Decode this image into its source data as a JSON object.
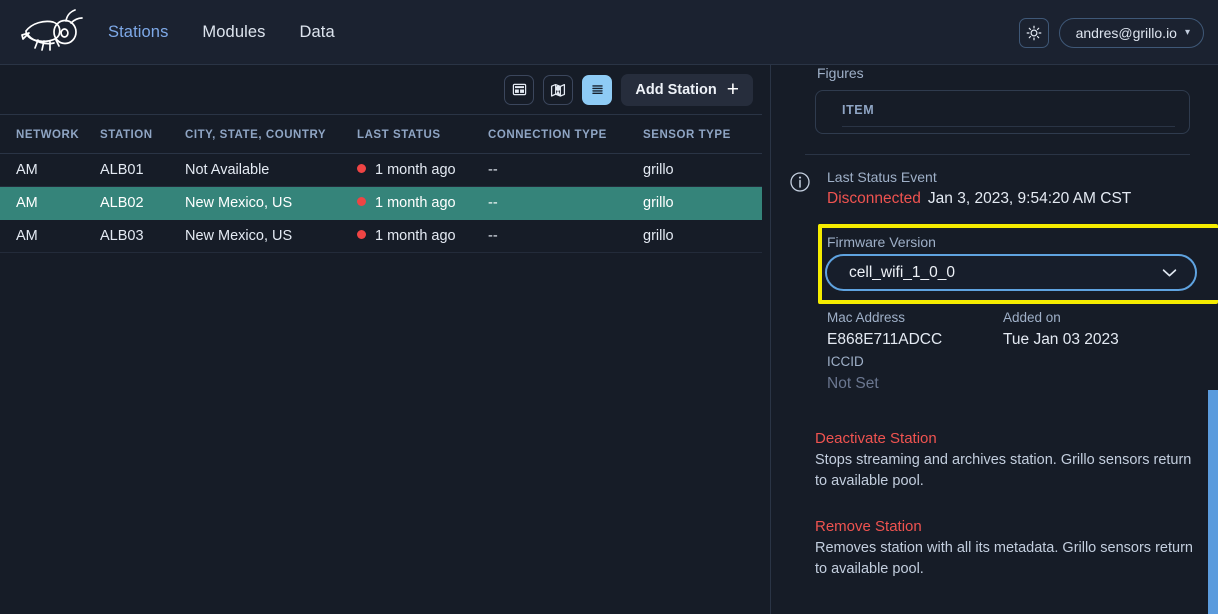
{
  "brand": {
    "logo_icon": "cricket-logo",
    "name": "Grillo"
  },
  "nav": {
    "links": [
      {
        "label": "Stations",
        "active": true
      },
      {
        "label": "Modules",
        "active": false
      },
      {
        "label": "Data",
        "active": false
      }
    ],
    "theme_toggle_icon": "sun-icon",
    "user": {
      "email": "andres@grillo.io",
      "caret_icon": "chevron-down-icon"
    }
  },
  "toolbar": {
    "views": [
      {
        "name": "cards-view",
        "icon": "layout-cards-icon",
        "active": false
      },
      {
        "name": "map-view",
        "icon": "map-pin-icon",
        "active": false
      },
      {
        "name": "list-view",
        "icon": "list-lines-icon",
        "active": true
      }
    ],
    "add_station_label": "Add Station",
    "add_station_icon": "plus-icon",
    "active_color": "#8ecbf5"
  },
  "table": {
    "columns": [
      "NETWORK",
      "STATION",
      "CITY, STATE, COUNTRY",
      "LAST STATUS",
      "CONNECTION TYPE",
      "SENSOR TYPE"
    ],
    "selected_row_color": "#35847a",
    "status_dot_color": "#ef4444",
    "rows": [
      {
        "network": "AM",
        "station": "ALB01",
        "city": "Not Available",
        "city_muted": true,
        "last_status": "1 month ago",
        "connection_type": "--",
        "sensor_type": "grillo",
        "selected": false
      },
      {
        "network": "AM",
        "station": "ALB02",
        "city": "New Mexico, US",
        "city_muted": false,
        "last_status": "1 month ago",
        "connection_type": "--",
        "sensor_type": "grillo",
        "selected": true
      },
      {
        "network": "AM",
        "station": "ALB03",
        "city": "New Mexico, US",
        "city_muted": false,
        "last_status": "1 month ago",
        "connection_type": "--",
        "sensor_type": "grillo",
        "selected": false
      }
    ]
  },
  "details": {
    "figures_label": "Figures",
    "figures_table_header": "ITEM",
    "info_icon": "info-circle-icon",
    "last_status_event_label": "Last Status Event",
    "last_status_event_state": "Disconnected",
    "last_status_event_state_color": "#ef5350",
    "last_status_event_time": "Jan 3, 2023, 9:54:20 AM CST",
    "firmware_label": "Firmware Version",
    "firmware_value": "cell_wifi_1_0_0",
    "firmware_caret_icon": "chevron-down-icon",
    "firmware_highlight_color": "#f5ec00",
    "firmware_border_color": "#5fa3e0",
    "mac_label": "Mac Address",
    "mac_value": "E868E711ADCC",
    "added_label": "Added on",
    "added_value": "Tue Jan 03 2023",
    "iccid_label": "ICCID",
    "iccid_value": "Not Set",
    "actions": [
      {
        "title": "Deactivate Station",
        "desc": "Stops streaming and archives station. Grillo sensors return to available pool."
      },
      {
        "title": "Remove Station",
        "desc": "Removes station with all its metadata. Grillo sensors return to available pool."
      }
    ],
    "action_color": "#ef5350"
  },
  "scrollbar": {
    "name": "panel-scrollbar",
    "thumb_color": "#5b9bdd"
  }
}
